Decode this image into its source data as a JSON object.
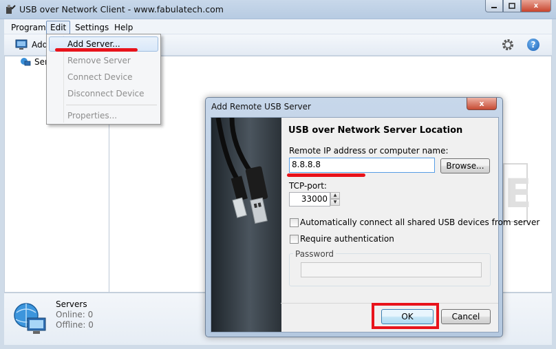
{
  "window": {
    "title": "USB over Network Client - www.fabulatech.com",
    "minimize_icon": "minimize-icon",
    "maximize_icon": "maximize-icon",
    "close_label": "x"
  },
  "menubar": {
    "items": [
      "Program",
      "Edit",
      "Settings",
      "Help"
    ],
    "active": "Edit"
  },
  "toolbar": {
    "add_label": "Add",
    "settings_icon": "gear-icon",
    "help_icon": "help-icon",
    "help_glyph": "?"
  },
  "tree": {
    "items": [
      {
        "label": "Ser",
        "icon": "server-icon"
      }
    ]
  },
  "status": {
    "title": "Servers",
    "online": "Online: 0",
    "offline": "Offline: 0",
    "icon": "network-globe-icon"
  },
  "background_glyph": "E",
  "edit_menu": {
    "items": [
      {
        "label": "Add Server...",
        "enabled": true
      },
      {
        "label": "Remove Server",
        "enabled": false
      },
      {
        "label": "Connect Device",
        "enabled": false
      },
      {
        "label": "Disconnect Device",
        "enabled": false
      },
      {
        "label": "Properties...",
        "enabled": false
      }
    ]
  },
  "dialog": {
    "title": "Add Remote USB Server",
    "close_label": "x",
    "heading": "USB over Network Server Location",
    "ip_label": "Remote IP address or computer name:",
    "ip_value": "8.8.8.8",
    "browse_label": "Browse...",
    "port_label": "TCP-port:",
    "port_value": "33000",
    "auto_connect_label": "Automatically connect all shared USB devices from server",
    "auto_connect_checked": false,
    "require_auth_label": "Require authentication",
    "require_auth_checked": false,
    "password_group_label": "Password",
    "password_value": "",
    "ok_label": "OK",
    "cancel_label": "Cancel"
  },
  "annotation_color": "#e8131b"
}
